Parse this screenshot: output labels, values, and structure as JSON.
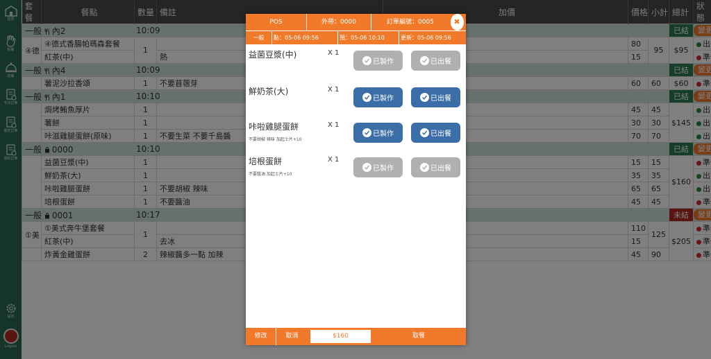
{
  "sidebar": {
    "items": [
      {
        "label": "首頁",
        "icon": "store-icon"
      },
      {
        "label": "點餐",
        "icon": "hand-icon"
      },
      {
        "label": "送餐",
        "icon": "bell-icon"
      },
      {
        "label": "今日訂單",
        "icon": "receipt-icon"
      },
      {
        "label": "歷史訂單",
        "icon": "receipt-icon"
      },
      {
        "label": "預約訂單",
        "icon": "receipt-icon"
      }
    ],
    "settings_label": "設定",
    "logout_label": "Logout"
  },
  "table": {
    "headers": [
      "套餐",
      "餐點",
      "數量",
      "備註",
      "加價",
      "價格",
      "小計",
      "總計",
      "狀態"
    ],
    "groups": [
      {
        "type": "一般",
        "icon": "utensils-icon",
        "name": "內2",
        "time": "10:09",
        "pay": "已結",
        "action": "變更",
        "lines": [
          {
            "set": "④德",
            "item": "④德式香腸帕瑪森套餐",
            "qty": "1",
            "note": "",
            "price": "80",
            "status": "出餐",
            "status_color": "g"
          },
          {
            "set": "",
            "item": "紅茶(中)",
            "qty": "",
            "note": "熱",
            "price": "15",
            "status": "準備",
            "status_color": "r"
          }
        ],
        "subtotal": "95",
        "total": "$95"
      },
      {
        "type": "一般",
        "icon": "utensils-icon",
        "name": "內4",
        "time": "10:09",
        "pay": "已結",
        "action": "變更",
        "lines": [
          {
            "set": "",
            "item": "薯泥沙拉香頌",
            "qty": "1",
            "note": "不要苜蓿芽",
            "price": "60",
            "subtotal": "60",
            "status": "準備",
            "status_color": "r"
          }
        ],
        "total": "$60"
      },
      {
        "type": "一般",
        "icon": "utensils-icon",
        "name": "內1",
        "time": "10:10",
        "pay": "已結",
        "action": "變更",
        "lines": [
          {
            "set": "",
            "item": "焗烤鮪魚厚片",
            "qty": "1",
            "note": "",
            "price": "45",
            "subtotal": "45",
            "status": "出餐",
            "status_color": "g"
          },
          {
            "set": "",
            "item": "薯餅",
            "qty": "1",
            "note": "",
            "price": "30",
            "subtotal": "30",
            "status": "出餐",
            "status_color": "g"
          },
          {
            "set": "",
            "item": "咔滋雞腿蛋餅(原味)",
            "qty": "1",
            "note": "不要生菜 不要千島醬",
            "price": "70",
            "subtotal": "70",
            "status": "出餐",
            "status_color": "g"
          }
        ],
        "total": "$145"
      },
      {
        "type": "一般",
        "icon": "bag-icon",
        "name": "0000",
        "time": "10:10",
        "pay": "已結",
        "action": "變更",
        "lines": [
          {
            "set": "",
            "item": "益菌豆漿(中)",
            "qty": "1",
            "note": "",
            "price": "15",
            "subtotal": "15",
            "status": "準備",
            "status_color": "r"
          },
          {
            "set": "",
            "item": "鮮奶茶(大)",
            "qty": "1",
            "note": "",
            "price": "35",
            "subtotal": "35",
            "status": "出餐",
            "status_color": "g"
          },
          {
            "set": "",
            "item": "咔啦雞腿蛋餅",
            "qty": "1",
            "note": "不要胡椒 辣味",
            "price": "65",
            "subtotal": "65",
            "status": "出餐",
            "status_color": "g"
          },
          {
            "set": "",
            "item": "培根蛋餅",
            "qty": "1",
            "note": "不要醬油",
            "price": "45",
            "subtotal": "45",
            "status": "準備",
            "status_color": "r"
          }
        ],
        "total": "$160"
      },
      {
        "type": "一般",
        "icon": "bag-icon",
        "name": "0001",
        "time": "10:17",
        "pay": "未結",
        "action": "變更",
        "lines": [
          {
            "set": "①美",
            "item": "①美式奔牛堡套餐",
            "qty": "1",
            "note": "",
            "price": "110",
            "status": "準備",
            "status_color": "r"
          },
          {
            "set": "",
            "item": "紅茶(中)",
            "qty": "",
            "note": "去冰",
            "price": "15",
            "status": "準備",
            "status_color": "r"
          },
          {
            "set": "",
            "item": "炸黃金雞蛋餅",
            "qty": "2",
            "note": "辣椒醬多一點 加辣",
            "price": "45",
            "subtotal": "90",
            "status": "準備",
            "status_color": "r"
          }
        ],
        "set_subtotal": "125",
        "total": "$205"
      }
    ]
  },
  "modal": {
    "pos_label": "POS",
    "takeout": "外帶：0000",
    "order_no": "訂單編號：0005",
    "type": "一般",
    "order_time": "點：05-06 09:56",
    "pre_time": "預：05-06 10:10",
    "update_time": "更新：05-06 09:56",
    "items": [
      {
        "name": "益菌豆漿(中)",
        "qty": "X 1",
        "note": "",
        "made_label": "已製作",
        "served_label": "已出餐",
        "made": "done",
        "served": "done"
      },
      {
        "name": "鮮奶茶(大)",
        "qty": "X 1",
        "note": "",
        "made_label": "已製作",
        "served_label": "已出餐",
        "made": "active",
        "served": "active"
      },
      {
        "name": "咔啦雞腿蛋餅",
        "qty": "X 1",
        "note": "不要胡椒 辣味  加起士片+10",
        "made_label": "已製作",
        "served_label": "已出餐",
        "made": "active",
        "served": "active"
      },
      {
        "name": "培根蛋餅",
        "qty": "X 1",
        "note": "不要醬油  加起士片+10",
        "made_label": "已製作",
        "served_label": "已出餐",
        "made": "done",
        "served": "done"
      }
    ],
    "footer": {
      "edit": "修改",
      "cancel": "取消",
      "total": "$160",
      "pickup": "取餐"
    }
  },
  "colors": {
    "accent": "#f07a2a",
    "sidebar": "#2c6b52",
    "paid": "#2d7a52",
    "unpaid": "#b02a22",
    "active_button": "#3b6ea6",
    "done_button": "#b0b0b0"
  }
}
